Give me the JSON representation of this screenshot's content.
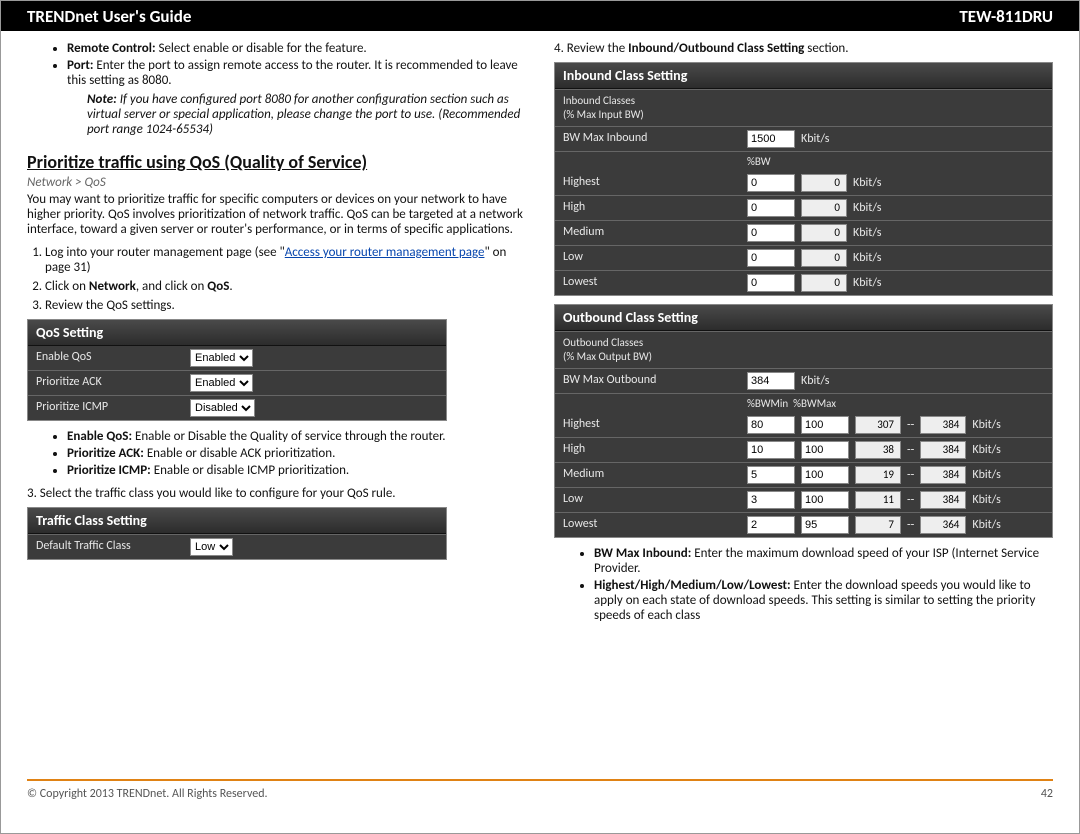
{
  "header": {
    "left": "TRENDnet User's Guide",
    "right": "TEW-811DRU"
  },
  "left": {
    "remote_bullets": [
      {
        "term": "Remote Control:",
        "desc": "Select enable or disable for the feature."
      },
      {
        "term": "Port:",
        "desc": "Enter the port to assign remote access to the router. It is recommended to leave this setting as 8080."
      }
    ],
    "note_label": "Note:",
    "note_text": "If you have configured port 8080 for another configuration section such as virtual server or special application, please change the port to use. (Recommended port range 1024-65534)",
    "section_title": "Prioritize traffic using QoS (Quality of Service)",
    "breadcrumb": "Network > QoS",
    "intro": "You may want to prioritize traffic for specific computers or devices on your network to have higher priority. QoS involves prioritization of network traffic. QoS can be targeted at a network interface, toward a given server or router's performance, or in terms of specific applications.",
    "steps": [
      {
        "pre": "Log into your router management page (see \"",
        "link": "Access your router management page",
        "post": "\" on page 31)"
      },
      {
        "html": "Click on <b>Network</b>, and click on <b>QoS</b>."
      },
      {
        "text": "Review the QoS settings."
      }
    ],
    "qos_panel": {
      "title": "QoS Setting",
      "rows": [
        {
          "label": "Enable QoS",
          "value": "Enabled"
        },
        {
          "label": "Prioritize ACK",
          "value": "Enabled"
        },
        {
          "label": "Prioritize ICMP",
          "value": "Disabled"
        }
      ]
    },
    "qos_bullets": [
      {
        "term": "Enable QoS:",
        "desc": "Enable or Disable the Quality of service through the router."
      },
      {
        "term": "Prioritize ACK:",
        "desc": "Enable or disable ACK prioritization."
      },
      {
        "term": "Prioritize ICMP:",
        "desc": "Enable or disable ICMP prioritization."
      }
    ],
    "step3_text": "3. Select the traffic class you would like to configure for your QoS rule.",
    "traffic_panel": {
      "title": "Traffic Class Setting",
      "label": "Default Traffic Class",
      "value": "Low"
    }
  },
  "right": {
    "step4_pre": "4. Review the ",
    "step4_bold": "Inbound/Outbound Class Setting",
    "step4_post": " section.",
    "inbound": {
      "title": "Inbound Class Setting",
      "sub1": "Inbound Classes",
      "sub2": "(% Max Input BW)",
      "bwmax_label": "BW Max Inbound",
      "bwmax_value": "1500",
      "bwmax_unit": "Kbit/s",
      "bw_header": "%BW",
      "rows": [
        {
          "label": "Highest",
          "a": "0",
          "b": "0",
          "unit": "Kbit/s"
        },
        {
          "label": "High",
          "a": "0",
          "b": "0",
          "unit": "Kbit/s"
        },
        {
          "label": "Medium",
          "a": "0",
          "b": "0",
          "unit": "Kbit/s"
        },
        {
          "label": "Low",
          "a": "0",
          "b": "0",
          "unit": "Kbit/s"
        },
        {
          "label": "Lowest",
          "a": "0",
          "b": "0",
          "unit": "Kbit/s"
        }
      ]
    },
    "outbound": {
      "title": "Outbound Class Setting",
      "sub1": "Outbound Classes",
      "sub2": "(% Max Output BW)",
      "bwmax_label": "BW Max Outbound",
      "bwmax_value": "384",
      "bwmax_unit": "Kbit/s",
      "bw_header": "%BWMin  %BWMax",
      "rows": [
        {
          "label": "Highest",
          "a": "80",
          "b": "100",
          "c": "307",
          "d": "384",
          "unit": "Kbit/s"
        },
        {
          "label": "High",
          "a": "10",
          "b": "100",
          "c": "38",
          "d": "384",
          "unit": "Kbit/s"
        },
        {
          "label": "Medium",
          "a": "5",
          "b": "100",
          "c": "19",
          "d": "384",
          "unit": "Kbit/s"
        },
        {
          "label": "Low",
          "a": "3",
          "b": "100",
          "c": "11",
          "d": "384",
          "unit": "Kbit/s"
        },
        {
          "label": "Lowest",
          "a": "2",
          "b": "95",
          "c": "7",
          "d": "364",
          "unit": "Kbit/s"
        }
      ]
    },
    "end_bullets": [
      {
        "term": "BW Max Inbound:",
        "desc": "Enter the maximum download speed of your ISP (Internet Service Provider."
      },
      {
        "term": "Highest/High/Medium/Low/Lowest:",
        "desc": "Enter the download speeds you would like to apply on each state of download speeds. This setting is similar to setting the priority speeds of each class"
      }
    ]
  },
  "footer": {
    "copyright": "© Copyright 2013 TRENDnet. All Rights Reserved.",
    "page": "42"
  }
}
